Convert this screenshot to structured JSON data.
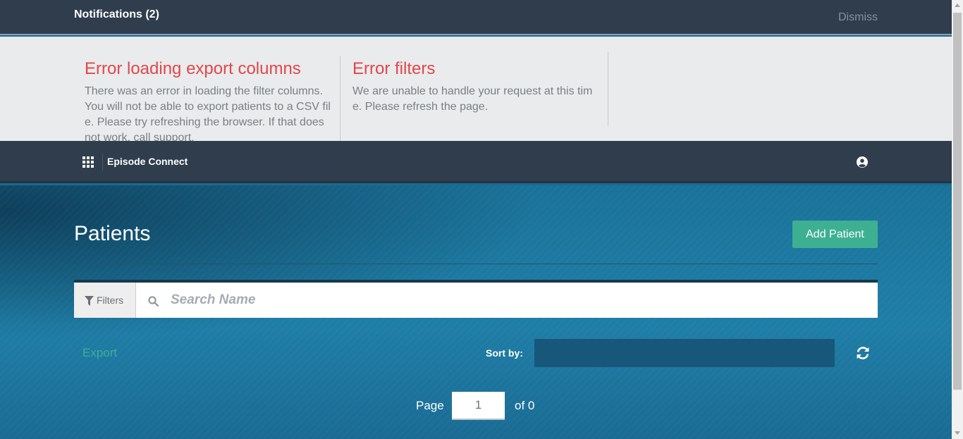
{
  "notifications": {
    "title": "Notifications (2)",
    "dismiss_label": "Dismiss",
    "items": [
      {
        "title": "Error loading export columns",
        "message": "There was an error in loading the filter columns. You will not be able to export patients to a CSV file. Please try refreshing the browser. If that does not work, call support."
      },
      {
        "title": "Error filters",
        "message": "We are unable to handle your request at this time. Please refresh the page."
      }
    ]
  },
  "navbar": {
    "brand": "Episode Connect",
    "apps_icon": "grid-icon",
    "user_icon": "user-circle-icon"
  },
  "main": {
    "title": "Patients",
    "add_button_label": "Add Patient",
    "filters_label": "Filters",
    "search": {
      "placeholder": "Search Name",
      "value": ""
    },
    "export_label": "Export",
    "sort_label": "Sort by:",
    "sort_value": "",
    "pagination": {
      "page_label": "Page",
      "current_page": "1",
      "of_label": "of 0"
    }
  },
  "colors": {
    "header_bg": "#2f3d4d",
    "error_title": "#e0474c",
    "accent_green": "#3db092",
    "hero_blue": "#1f7ea7"
  }
}
